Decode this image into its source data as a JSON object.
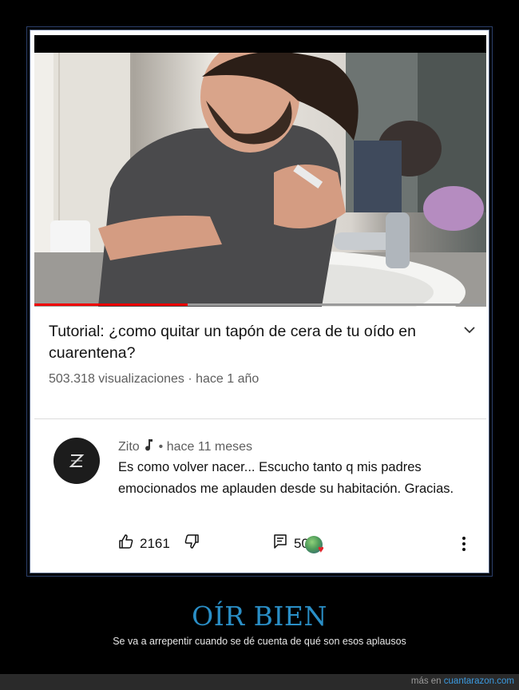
{
  "video": {
    "title": "Tutorial: ¿como quitar un tapón de cera de tu oído en cuarentena?",
    "meta": "503.318 visualizaciones · hace 1 año",
    "progress": 0.34
  },
  "comment": {
    "author": "Zito",
    "time": "• hace 11 meses",
    "text": "Es como volver nacer... Escucho tanto q mis padres emocionados me aplauden desde su habitación. Gracias.",
    "likes": "2161",
    "replies": "50"
  },
  "caption": {
    "title": "OÍR BIEN",
    "subtitle": "Se va a arrepentir cuando se dé cuenta de qué son esos aplausos"
  },
  "footer": {
    "prefix": "más en",
    "site": "cuantarazon.com"
  },
  "colors": {
    "accent": "#2a8fc7",
    "progress": "#e00000",
    "heart": "#e0242a"
  },
  "icons": [
    "chevron-down-icon",
    "music-note-icon",
    "thumbs-up-icon",
    "thumbs-down-icon",
    "comment-icon",
    "heart-icon",
    "more-vert-icon"
  ]
}
